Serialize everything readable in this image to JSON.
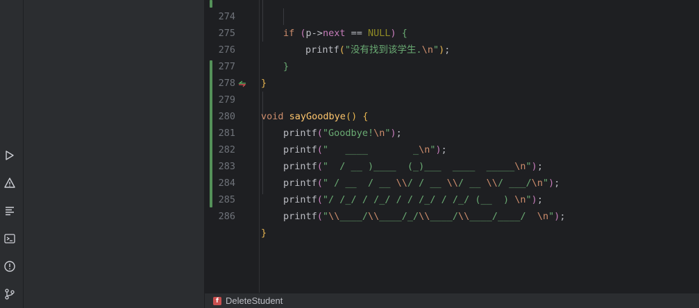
{
  "toolstrip": {
    "items": [
      {
        "name": "run-icon"
      },
      {
        "name": "warning-icon"
      },
      {
        "name": "structure-icon"
      },
      {
        "name": "terminal-icon"
      },
      {
        "name": "problems-icon"
      },
      {
        "name": "git-icon"
      }
    ]
  },
  "editor": {
    "lines": [
      {
        "num": "274",
        "code": "if (p->next == NULL) {"
      },
      {
        "num": "275",
        "code": "printf(\"没有找到该学生.\\n\");"
      },
      {
        "num": "276",
        "code": "}"
      },
      {
        "num": "277",
        "code": "}"
      },
      {
        "num": "278",
        "code": ""
      },
      {
        "num": "279",
        "code": "void sayGoodbye() {"
      },
      {
        "num": "280",
        "code": "printf(\"Goodbye!\\n\");"
      },
      {
        "num": "281",
        "code": "printf(\"   ____        _\\n\");"
      },
      {
        "num": "282",
        "code": "printf(\"  / __ )____  (_)___  ____  _____\\n\");"
      },
      {
        "num": "283",
        "code": "printf(\" / __  / __ \\\\/ / __ \\\\/ __ \\\\/ ___/\\n\");"
      },
      {
        "num": "284",
        "code": "printf(\"/ /_/ / /_/ / / /_/ / /_/ (__  ) \\n\");"
      },
      {
        "num": "285",
        "code": "printf(\"\\\\____/\\\\____/_/\\\\____/\\\\____/____/  \\n\");"
      },
      {
        "num": "286",
        "code": "}"
      }
    ]
  },
  "statusbar": {
    "file_badge": "f",
    "breadcrumb": "DeleteStudent"
  }
}
